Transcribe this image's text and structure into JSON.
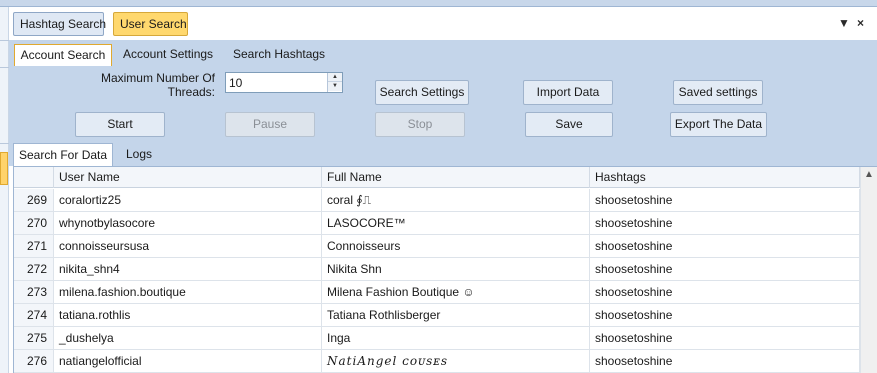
{
  "doc_tabs": {
    "hashtag_search": "Hashtag Search",
    "user_search": "User Search"
  },
  "pane_controls": {
    "pin_glyph": "▼",
    "close_glyph": "×"
  },
  "section_tabs": {
    "account_search": "Account Search",
    "account_settings": "Account Settings",
    "search_hashtags": "Search Hashtags"
  },
  "toolbar": {
    "threads_label_line1": "Maximum Number Of",
    "threads_label_line2": "Threads:",
    "threads_value": "10",
    "spin_up": "▲",
    "spin_down": "▼",
    "search_settings": "Search Settings",
    "import_data": "Import Data",
    "saved_settings": "Saved settings",
    "start": "Start",
    "pause": "Pause",
    "stop": "Stop",
    "save": "Save",
    "export_data": "Export The Data"
  },
  "data_tabs": {
    "search_for_data": "Search For Data",
    "logs": "Logs"
  },
  "table": {
    "columns": [
      "User Name",
      "Full Name",
      "Hashtags"
    ],
    "rows": [
      {
        "num": "269",
        "user": "coralortiz25",
        "full": "coral ∮⎍",
        "tag": "shoosetoshine"
      },
      {
        "num": "270",
        "user": "whynotbylasocore",
        "full": "LASOCORE™",
        "tag": "shoosetoshine"
      },
      {
        "num": "271",
        "user": "connoisseursusa",
        "full": "Connoisseurs",
        "tag": "shoosetoshine"
      },
      {
        "num": "272",
        "user": "nikita_shn4",
        "full": "Nikita Shn",
        "tag": "shoosetoshine"
      },
      {
        "num": "273",
        "user": "milena.fashion.boutique",
        "full": "Milena Fashion Boutique ☺",
        "tag": "shoosetoshine"
      },
      {
        "num": "274",
        "user": "tatiana.rothlis",
        "full": "Tatiana Rothlisberger",
        "tag": "shoosetoshine"
      },
      {
        "num": "275",
        "user": "_dushelya",
        "full": "Inga",
        "tag": "shoosetoshine"
      },
      {
        "num": "276",
        "user": "natiangelofficial",
        "full": "NatiAngel ᴄᴏᴜsᴇs",
        "tag": "shoosetoshine"
      }
    ]
  },
  "scroll": {
    "up_glyph": "▲"
  }
}
